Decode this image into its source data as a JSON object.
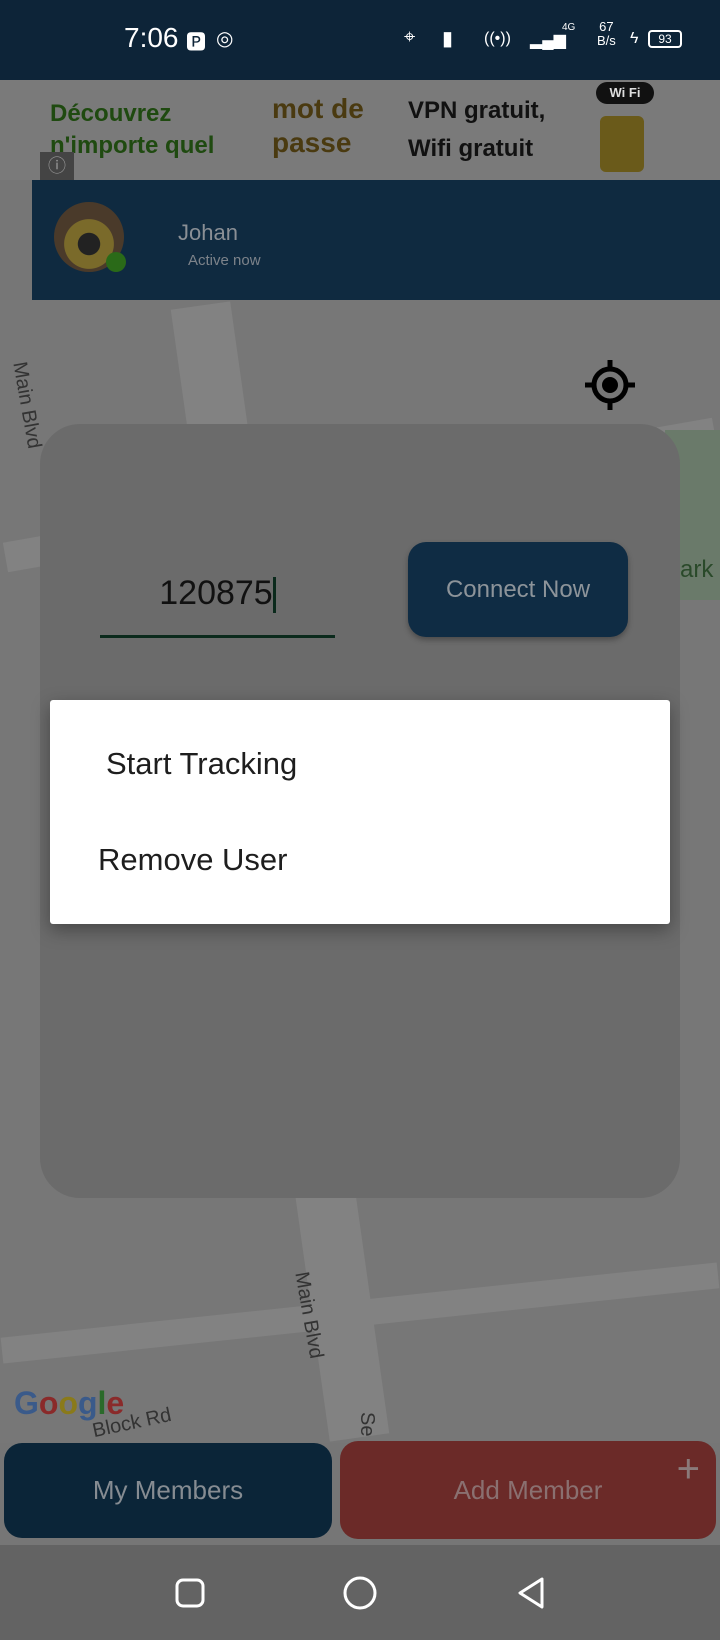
{
  "status_bar": {
    "time": "7:06",
    "net_speed_value": "67",
    "net_speed_unit": "B/s",
    "network": "4G",
    "battery": "93"
  },
  "ad": {
    "text1_line1": "Découvrez",
    "text1_line2": "n'importe quel",
    "text2_line1": "mot de",
    "text2_line2": "passe",
    "text3_line1": "VPN gratuit,",
    "text3_line2": "Wifi gratuit",
    "badge": "Wi Fi",
    "info_icon": "info-icon"
  },
  "user": {
    "name": "Johan",
    "status": "Active now",
    "status_color": "#2a6a18"
  },
  "map": {
    "labels": [
      "Main Blvd",
      "Main Blvd",
      "Block Rd",
      "ark",
      "Se"
    ],
    "attribution": "Google"
  },
  "connect": {
    "code": "120875",
    "button": "Connect Now"
  },
  "menu": {
    "items": [
      "Start Tracking",
      "Remove User"
    ]
  },
  "bottom": {
    "my_members": "My Members",
    "add_member": "Add Member",
    "plus": "+"
  },
  "colors": {
    "primary": "#0f2c44",
    "accent": "#6b2a28"
  }
}
